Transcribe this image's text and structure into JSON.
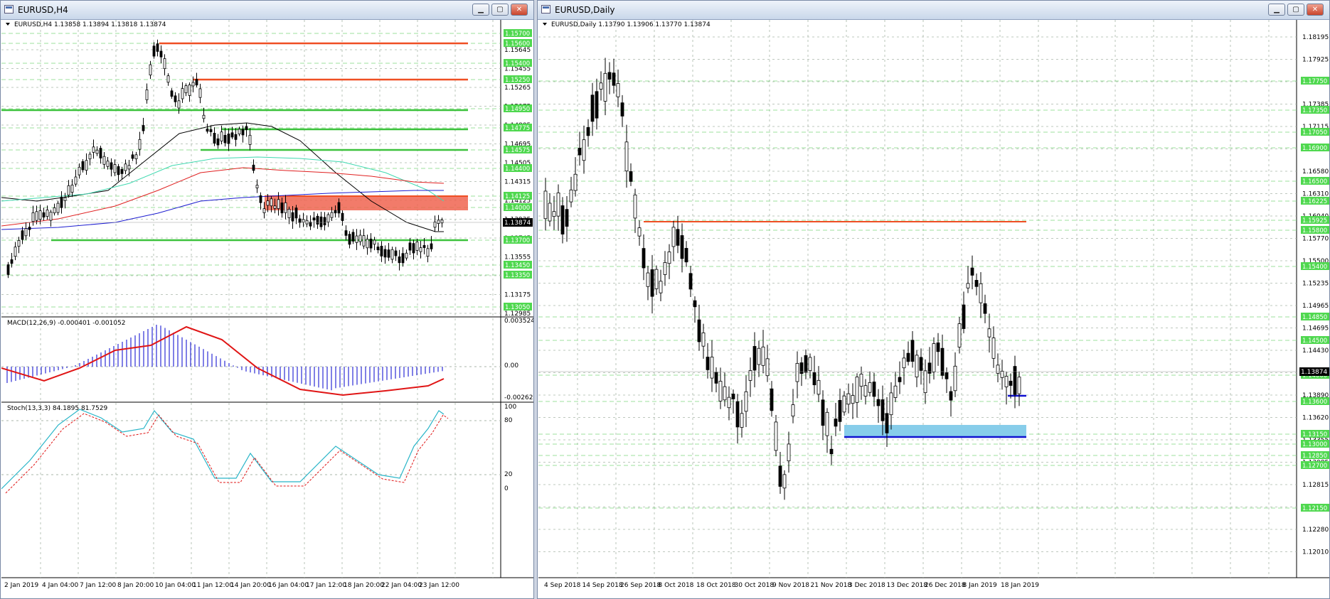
{
  "colors": {
    "grid": "#a9b6a9",
    "bull": "#ffffff",
    "bear": "#000000",
    "resistance": "#ef4f23",
    "support": "#3cc23c",
    "zone_red": "#f06450",
    "zone_blue": "#87cdea",
    "ma_black": "#000000",
    "ma_teal": "#3fd9b0",
    "ma_red": "#e02020",
    "ma_blue": "#1c1cd0",
    "macd_hist": "#2b2bd6",
    "macd_signal": "#e01515",
    "stoch_main": "#28b5c8",
    "stoch_signal": "#e01515",
    "price_tag_bg": "#000000",
    "level_tag_bg": "#4fd84f"
  },
  "left_window": {
    "title": "EURUSD,H4",
    "buttons": {
      "minimize": "▁",
      "maximize": "▢",
      "close": "✕"
    },
    "chart": {
      "header": "EURUSD,H4  1.13858 1.13894 1.13818 1.13874",
      "price_axis": [
        "1.15645",
        "1.15455",
        "1.15265",
        "1.15075",
        "1.14885",
        "1.14695",
        "1.14505",
        "1.14315",
        "1.14125",
        "1.13935",
        "1.13745",
        "1.13555",
        "1.13365",
        "1.13175",
        "1.12985"
      ],
      "level_tags": [
        "1.15700",
        "1.15600",
        "1.15400",
        "1.15250",
        "1.14950",
        "1.14775",
        "1.14575",
        "1.14400",
        "1.14125",
        "1.14000",
        "1.13700",
        "1.13450",
        "1.13350",
        "1.13050"
      ],
      "current_price": "1.13874",
      "time_axis": [
        "2 Jan 2019",
        "4 Jan 04:00",
        "7 Jan 12:00",
        "8 Jan 20:00",
        "10 Jan 04:00",
        "11 Jan 12:00",
        "14 Jan 20:00",
        "16 Jan 04:00",
        "17 Jan 12:00",
        "18 Jan 20:00",
        "22 Jan 04:00",
        "23 Jan 12:00"
      ],
      "macd": {
        "label": "MACD(12,26,9) -0.000401 -0.001052",
        "scale": [
          "0.003524",
          "0.00",
          "-0.002621"
        ]
      },
      "stoch": {
        "label": "Stoch(13,3,3) 84.1895 81.7529",
        "scale": [
          "100",
          "80",
          "20",
          "0"
        ]
      }
    }
  },
  "right_window": {
    "title": "EURUSD,Daily",
    "buttons": {
      "minimize": "▁",
      "maximize": "▢",
      "close": "✕"
    },
    "chart": {
      "header": "EURUSD,Daily  1.13790 1.13906 1.13770 1.13874",
      "price_axis": [
        "1.18195",
        "1.17925",
        "1.17655",
        "1.17385",
        "1.17115",
        "1.16850",
        "1.16580",
        "1.16310",
        "1.16040",
        "1.15770",
        "1.15500",
        "1.15235",
        "1.14965",
        "1.14695",
        "1.14430",
        "1.14160",
        "1.13890",
        "1.13620",
        "1.13355",
        "1.13085",
        "1.12815",
        "1.12545",
        "1.12280",
        "1.12010"
      ],
      "level_tags": [
        "1.17750",
        "1.17350",
        "1.17050",
        "1.16900",
        "1.16500",
        "1.16225",
        "1.15925",
        "1.15800",
        "1.15400",
        "1.14850",
        "1.14500",
        "1.14000",
        "1.13600",
        "1.13150",
        "1.13000",
        "1.12850",
        "1.12700",
        "1.12150"
      ],
      "current_price": "1.13874",
      "time_axis": [
        "4 Sep 2018",
        "14 Sep 2018",
        "26 Sep 2018",
        "8 Oct 2018",
        "18 Oct 2018",
        "30 Oct 2018",
        "9 Nov 2018",
        "21 Nov 2018",
        "3 Dec 2018",
        "13 Dec 2018",
        "26 Dec 2018",
        "8 Jan 2019",
        "18 Jan 2019"
      ]
    }
  }
}
